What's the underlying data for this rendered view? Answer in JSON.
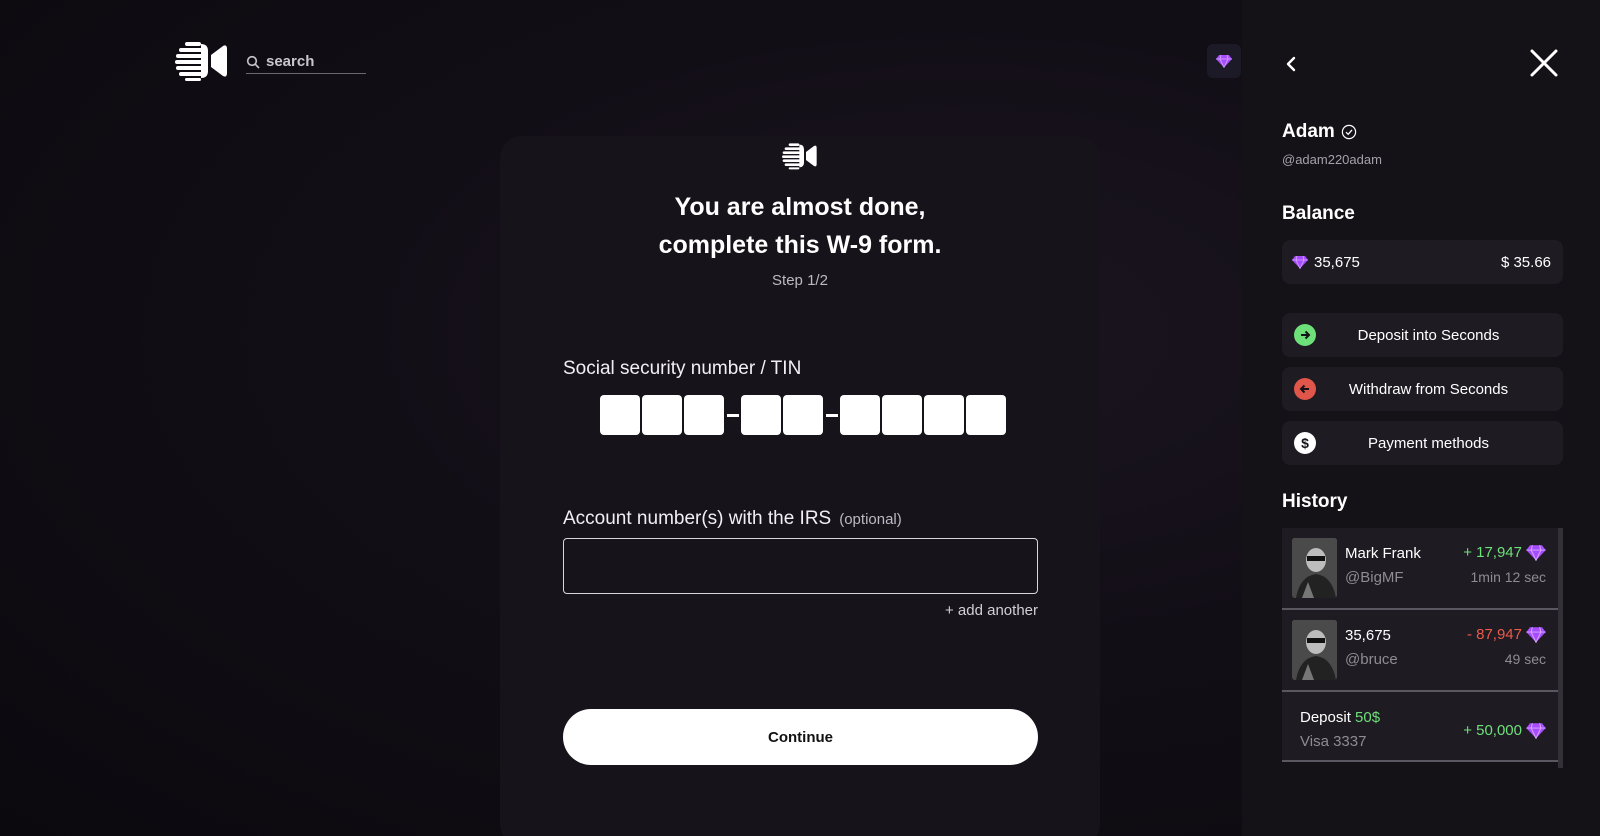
{
  "header": {
    "search_placeholder": "search",
    "logo_icon": "video-camera-logo-icon",
    "gem_icon": "diamond-icon"
  },
  "form": {
    "title_line1": "You are almost done,",
    "title_line2": "complete this W-9 form.",
    "step": "Step 1/2",
    "ssn_label": "Social security number / TIN",
    "ssn_digits": [
      "",
      "",
      "",
      "",
      "",
      "",
      "",
      "",
      ""
    ],
    "irs_label": "Account number(s) with the IRS",
    "irs_optional": "(optional)",
    "irs_value": "",
    "add_another": "+ add another",
    "continue_label": "Continue"
  },
  "panel": {
    "user_name": "Adam",
    "user_handle": "@adam220adam",
    "balance_title": "Balance",
    "balance_gems": "35,675",
    "balance_usd": "$ 35.66",
    "actions": [
      {
        "label": "Deposit into Seconds",
        "icon": "arrow-right-circle-icon",
        "color": "#6ee07a"
      },
      {
        "label": "Withdraw from Seconds",
        "icon": "arrow-left-circle-icon",
        "color": "#e0564a"
      },
      {
        "label": "Payment methods",
        "icon": "dollar-circle-icon",
        "color": "#ffffff"
      }
    ],
    "history_title": "History",
    "history": [
      {
        "name": "Mark Frank",
        "handle": "@BigMF",
        "amount": "+ 17,947",
        "time": "1min 12 sec",
        "type": "pos"
      },
      {
        "name": "35,675",
        "handle": "@bruce",
        "amount": "- 87,947",
        "time": "49 sec",
        "type": "neg"
      }
    ],
    "deposit": {
      "label": "Deposit",
      "amount_usd": "50$",
      "card": "Visa 3337",
      "amount": "+ 50,000"
    }
  },
  "colors": {
    "accent_gem": "#a64dff",
    "positive": "#6ee07a",
    "negative": "#ec5a4b"
  }
}
